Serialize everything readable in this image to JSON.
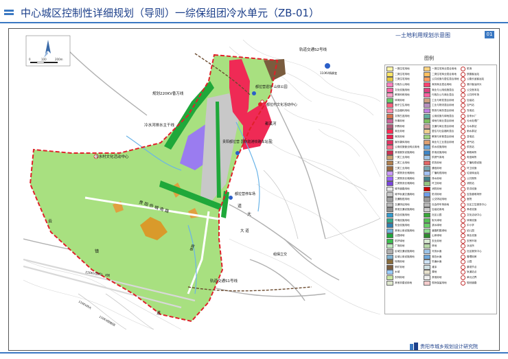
{
  "header": {
    "title": "中心城区控制性详细规划（导则）一综保组团冷水单元（ZB-01）"
  },
  "panel": {
    "title": "—土地利用规划示意图",
    "number": "01",
    "legend_title": "图例"
  },
  "scale_bar": {
    "labels": [
      "0",
      "100",
      "200m"
    ]
  },
  "map_labels": {
    "rail_82": "轨道交通S2号线",
    "substation": "110KV杨柳变",
    "power_line": "规划220KV香万线",
    "trunk_pipe": "冷水河排水主干线",
    "activity_center": "冷水村文化活动中心",
    "park": "都拉营遗址\n山体公园",
    "village_center": "都拉村文化活动中心",
    "river": "都溪河",
    "rail_station": "贵阳都拉营\n国际陆港铁路车站",
    "transport_plaza": "都拉营停车场",
    "road_guiyang": "贵 阳 侨 城 南 路",
    "road_dazao": "大 道",
    "road_rail": "铁路",
    "power_line2": "220KV回旭Ⅰ、Ⅱ回",
    "high_voltage_a": "110KV双火",
    "high_voltage_b": "110KV回旭Ⅰ回",
    "interchange": "组保立交",
    "rail_81": "轨道交通S1号线",
    "road_chengdu": "大",
    "road_yan": "盐",
    "road_dao": "道",
    "road_yun": "云",
    "road_zhen": "镇",
    "road_dao2": "道"
  },
  "legend": {
    "col1": [
      {
        "code": "R1",
        "label": "一类住宅用地",
        "color": "#fff4a8"
      },
      {
        "code": "R2",
        "label": "二类住宅用地",
        "color": "#ffe566"
      },
      {
        "code": "R3",
        "label": "三类住宅用地",
        "color": "#e6c840"
      },
      {
        "code": "A1",
        "label": "行政办公用地",
        "color": "#ff7fbf"
      },
      {
        "code": "A2",
        "label": "文化设施用地",
        "color": "#ff66a6"
      },
      {
        "code": "A3",
        "label": "教育科研用地",
        "color": "#ff9ec7"
      },
      {
        "code": "A4",
        "label": "体育用地",
        "color": "#66cc66"
      },
      {
        "code": "A5",
        "label": "医疗卫生用地",
        "color": "#ff5f7e"
      },
      {
        "code": "A6",
        "label": "社会福利用地",
        "color": "#ff88aa"
      },
      {
        "code": "A7",
        "label": "文物古迹用地",
        "color": "#d9734e"
      },
      {
        "code": "A8",
        "label": "外事用地",
        "color": "#cc6699"
      },
      {
        "code": "A9",
        "label": "宗教用地",
        "color": "#b35b7a"
      },
      {
        "code": "B1",
        "label": "商业用地",
        "color": "#ff2d55"
      },
      {
        "code": "B2",
        "label": "商务用地",
        "color": "#f02050"
      },
      {
        "code": "B3",
        "label": "娱乐康体用地",
        "color": "#e23463"
      },
      {
        "code": "B4",
        "label": "公用设施营业网点用地",
        "color": "#ff6f8d"
      },
      {
        "code": "B9",
        "label": "其他服务设施用地",
        "color": "#cc3355"
      },
      {
        "code": "M1",
        "label": "一类工业用地",
        "color": "#c8a070"
      },
      {
        "code": "M2",
        "label": "二类工业用地",
        "color": "#b08050"
      },
      {
        "code": "M3",
        "label": "三类工业用地",
        "color": "#9a6a40"
      },
      {
        "code": "W1",
        "label": "一类物流仓储用地",
        "color": "#cc99ff"
      },
      {
        "code": "W2",
        "label": "二类物流仓储用地",
        "color": "#9966ff"
      },
      {
        "code": "W3",
        "label": "三类物流仓储用地",
        "color": "#7a44dd"
      },
      {
        "code": "S1",
        "label": "城市道路用地",
        "color": "#e6e6e6"
      },
      {
        "code": "S2",
        "label": "城市轨道交通用地",
        "color": "#c8c8c8"
      },
      {
        "code": "S3",
        "label": "交通枢纽用地",
        "color": "#a0a0a0"
      },
      {
        "code": "S4",
        "label": "交通场站用地",
        "color": "#b8b8b8"
      },
      {
        "code": "S9",
        "label": "其他交通设施用地",
        "color": "#909090"
      },
      {
        "code": "U1",
        "label": "供应设施用地",
        "color": "#3399cc"
      },
      {
        "code": "U2",
        "label": "环境设施用地",
        "color": "#33aa88"
      },
      {
        "code": "U3",
        "label": "安全设施用地",
        "color": "#2d7fb0"
      },
      {
        "code": "U9",
        "label": "其他公用设施用地",
        "color": "#6fb3d9"
      },
      {
        "code": "G1",
        "label": "公园绿地",
        "color": "#1fa83a"
      },
      {
        "code": "G2",
        "label": "防护绿地",
        "color": "#3cbf50"
      },
      {
        "code": "G3",
        "label": "广场用地",
        "color": "#c0e8c0"
      },
      {
        "code": "H2",
        "label": "区域交通设施用地",
        "color": "#b0b0b0"
      },
      {
        "code": "H3",
        "label": "区域公用设施用地",
        "color": "#7fb2d0"
      },
      {
        "code": "H4",
        "label": "特殊用地",
        "color": "#8a6d3b"
      },
      {
        "code": "H5",
        "label": "采矿用地",
        "color": "#7a5c3e"
      },
      {
        "code": "E1",
        "label": "水域",
        "color": "#99ccff"
      },
      {
        "code": "E2",
        "label": "农林用地",
        "color": "#c8e6a0"
      },
      {
        "code": "E9",
        "label": "其他非建设用地",
        "color": "#dde6cc"
      }
    ],
    "col2": [
      {
        "code": "Rb",
        "label": "一类住宅商业混合用地",
        "color": "#ffd27f"
      },
      {
        "code": "Rb",
        "label": "二类住宅商业混合用地",
        "color": "#ffc060"
      },
      {
        "code": "Ra",
        "label": "公共设施与居住混合用地",
        "color": "#ff9f60"
      },
      {
        "code": "Bb",
        "label": "商务商业混合用地",
        "color": "#ff4070"
      },
      {
        "code": "Bu",
        "label": "商业与公用设施混合",
        "color": "#e04080"
      },
      {
        "code": "Ab",
        "label": "行政办公与商业混合",
        "color": "#ff60a0"
      },
      {
        "code": "Mb",
        "label": "工业与研发混合用地",
        "color": "#d0a080"
      },
      {
        "code": "Mw",
        "label": "工业与物流混合用地",
        "color": "#b890c0"
      },
      {
        "code": "Wb",
        "label": "物流与商务混合用地",
        "color": "#c080e0"
      },
      {
        "code": "Ug",
        "label": "公用设施与绿地混合",
        "color": "#5fb0a0"
      },
      {
        "code": "Gb",
        "label": "绿地与商业混合用地",
        "color": "#80c060"
      },
      {
        "code": "Sb",
        "label": "交通与商业混合用地",
        "color": "#d0a0a0"
      },
      {
        "code": "Rs",
        "label": "居住与社会福利混合",
        "color": "#f0d090"
      },
      {
        "code": "Ae",
        "label": "教育与体育混合用地",
        "color": "#a0d080"
      },
      {
        "code": "Bm",
        "label": "商业与工业混合用地",
        "color": "#e0a070"
      },
      {
        "code": "Uw",
        "label": "供水设施用地",
        "color": "#6fa8dc"
      },
      {
        "code": "Ue",
        "label": "供电设施用地",
        "color": "#3d85c6"
      },
      {
        "code": "Ug",
        "label": "供燃气用地",
        "color": "#9fc5e8"
      },
      {
        "code": "Uh",
        "label": "供热用地",
        "color": "#e06666"
      },
      {
        "code": "Ut",
        "label": "通信用地",
        "color": "#76a5af"
      },
      {
        "code": "Ub",
        "label": "广播电视用地",
        "color": "#a4c2f4"
      },
      {
        "code": "Us",
        "label": "排水用地",
        "color": "#45818e"
      },
      {
        "code": "Ua",
        "label": "环卫用地",
        "color": "#93c47d"
      },
      {
        "code": "Uf",
        "label": "消防用地",
        "color": "#cc0000"
      },
      {
        "code": "Up",
        "label": "防洪用地",
        "color": "#6d9eeb"
      },
      {
        "code": "Sp",
        "label": "公交场站用地",
        "color": "#999999"
      },
      {
        "code": "Sc",
        "label": "社会停车场用地",
        "color": "#b7b7b7"
      },
      {
        "code": "Sr",
        "label": "加油站用地",
        "color": "#cccccc"
      },
      {
        "code": "Gp",
        "label": "社区公园",
        "color": "#38a838"
      },
      {
        "code": "Gs",
        "label": "街头绿地",
        "color": "#55c055"
      },
      {
        "code": "Gw",
        "label": "滨水绿地",
        "color": "#6acf6a"
      },
      {
        "code": "Gr",
        "label": "道路附属绿地",
        "color": "#8fdc8f"
      },
      {
        "code": "Gm",
        "label": "山体绿地",
        "color": "#2e8b2e"
      },
      {
        "code": "Ga",
        "label": "农业用地",
        "color": "#d9ead3"
      },
      {
        "code": "Gf",
        "label": "林地",
        "color": "#b6d7a8"
      },
      {
        "code": "Ew",
        "label": "河流水面",
        "color": "#9fc5e8"
      },
      {
        "code": "El",
        "label": "湖泊水面",
        "color": "#6fa8dc"
      },
      {
        "code": "Ep",
        "label": "坑塘水面",
        "color": "#cfe2f3"
      },
      {
        "code": "Es",
        "label": "滩涂",
        "color": "#d0e0e3"
      },
      {
        "code": "Eb",
        "label": "裸地",
        "color": "#e6e0cc"
      },
      {
        "code": "Eo",
        "label": "其他用地",
        "color": "#eeeeee"
      },
      {
        "code": "Ex",
        "label": "现状保留用地",
        "color": "#f4cccc"
      }
    ],
    "col3": [
      {
        "icon": "机",
        "label": "机场"
      },
      {
        "icon": "铁",
        "label": "铁路客运站"
      },
      {
        "icon": "长",
        "label": "公路长途客运站"
      },
      {
        "icon": "港",
        "label": "港口客运码头"
      },
      {
        "icon": "交",
        "label": "公交首末站"
      },
      {
        "icon": "P",
        "label": "公共停车场"
      },
      {
        "icon": "加",
        "label": "加油站"
      },
      {
        "icon": "气",
        "label": "加气站"
      },
      {
        "icon": "充",
        "label": "充电站"
      },
      {
        "icon": "水",
        "label": "自来水厂"
      },
      {
        "icon": "污",
        "label": "污水处理厂"
      },
      {
        "icon": "泵",
        "label": "污水泵站"
      },
      {
        "icon": "雨",
        "label": "雨水泵站"
      },
      {
        "icon": "变",
        "label": "变电站"
      },
      {
        "icon": "燃",
        "label": "燃气站"
      },
      {
        "icon": "热",
        "label": "供热站"
      },
      {
        "icon": "邮",
        "label": "邮政局所"
      },
      {
        "icon": "电",
        "label": "电信局所"
      },
      {
        "icon": "广",
        "label": "广播电视设施"
      },
      {
        "icon": "环",
        "label": "环卫设施"
      },
      {
        "icon": "转",
        "label": "垃圾转运站"
      },
      {
        "icon": "厕",
        "label": "公共厕所"
      },
      {
        "icon": "消",
        "label": "消防站"
      },
      {
        "icon": "防",
        "label": "防洪设施"
      },
      {
        "icon": "避",
        "label": "应急避难场所"
      },
      {
        "icon": "医",
        "label": "医院"
      },
      {
        "icon": "卫",
        "label": "社区卫生服务中心"
      },
      {
        "icon": "养",
        "label": "养老设施"
      },
      {
        "icon": "文",
        "label": "文化活动中心"
      },
      {
        "icon": "体",
        "label": "体育设施"
      },
      {
        "icon": "学",
        "label": "中小学"
      },
      {
        "icon": "幼",
        "label": "幼儿园"
      },
      {
        "icon": "商",
        "label": "商业设施"
      },
      {
        "icon": "菜",
        "label": "农贸市场"
      },
      {
        "icon": "派",
        "label": "派出所"
      },
      {
        "icon": "社",
        "label": "社区服务中心"
      },
      {
        "icon": "管",
        "label": "管理用房"
      },
      {
        "icon": "公",
        "label": "公园"
      },
      {
        "icon": "景",
        "label": "景观节点"
      },
      {
        "icon": "站",
        "label": "轨道站点"
      },
      {
        "icon": "界",
        "label": "单元边界"
      },
      {
        "icon": "线",
        "label": "规划道路"
      }
    ]
  },
  "footer": {
    "org": "贵阳市城乡规划设计研究院"
  }
}
